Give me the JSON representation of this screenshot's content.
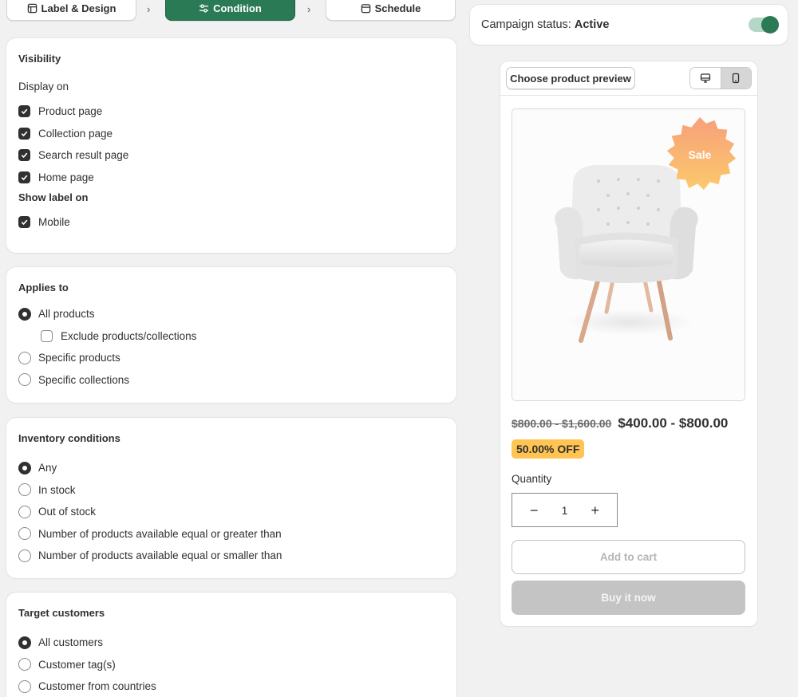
{
  "stepper": {
    "steps": [
      {
        "label": "Label & Design",
        "icon": "layout-icon"
      },
      {
        "label": "Condition",
        "icon": "sliders-icon"
      },
      {
        "label": "Schedule",
        "icon": "calendar-icon"
      }
    ],
    "active_step": 1
  },
  "visibility": {
    "title": "Visibility",
    "display_on_label": "Display on",
    "display_on_items": [
      {
        "label": "Product page",
        "checked": true
      },
      {
        "label": "Collection page",
        "checked": true
      },
      {
        "label": "Search result page",
        "checked": true
      },
      {
        "label": "Home page",
        "checked": true
      }
    ],
    "show_label_on_label": "Show label on",
    "show_label_on_items": [
      {
        "label": "Mobile",
        "checked": true
      }
    ]
  },
  "applies_to": {
    "title": "Applies to",
    "options": [
      {
        "label": "All products",
        "selected": true
      },
      {
        "label": "Exclude products/collections",
        "checked": false
      },
      {
        "label": "Specific products",
        "selected": false
      },
      {
        "label": "Specific collections",
        "selected": false
      }
    ]
  },
  "inventory": {
    "title": "Inventory conditions",
    "options": [
      {
        "label": "Any",
        "selected": true
      },
      {
        "label": "In stock",
        "selected": false
      },
      {
        "label": "Out of stock",
        "selected": false
      },
      {
        "label": "Number of products available equal or greater than",
        "selected": false
      },
      {
        "label": "Number of products available equal or smaller than",
        "selected": false
      }
    ]
  },
  "target": {
    "title": "Target customers",
    "options": [
      {
        "label": "All customers",
        "selected": true
      },
      {
        "label": "Customer tag(s)",
        "selected": false
      },
      {
        "label": "Customer from countries",
        "selected": false
      }
    ]
  },
  "status": {
    "label": "Campaign status:",
    "value": "Active",
    "enabled": true
  },
  "preview": {
    "choose_button": "Choose product preview",
    "devices": [
      {
        "icon": "desktop-icon",
        "active": false
      },
      {
        "icon": "mobile-icon",
        "active": true
      }
    ],
    "sale_badge": "Sale",
    "old_price": "$800.00 - $1,600.00",
    "new_price": "$400.00 - $800.00",
    "discount": "50.00% OFF",
    "quantity_label": "Quantity",
    "quantity_value": "1",
    "minus": "−",
    "plus": "+",
    "add_to_cart": "Add to cart",
    "buy_now": "Buy it now"
  },
  "colors": {
    "accent": "#2a7a56",
    "badge_yellow": "#ffc452",
    "sale_gradient_top": "#f7a07a",
    "sale_gradient_bottom": "#fcc96c"
  }
}
